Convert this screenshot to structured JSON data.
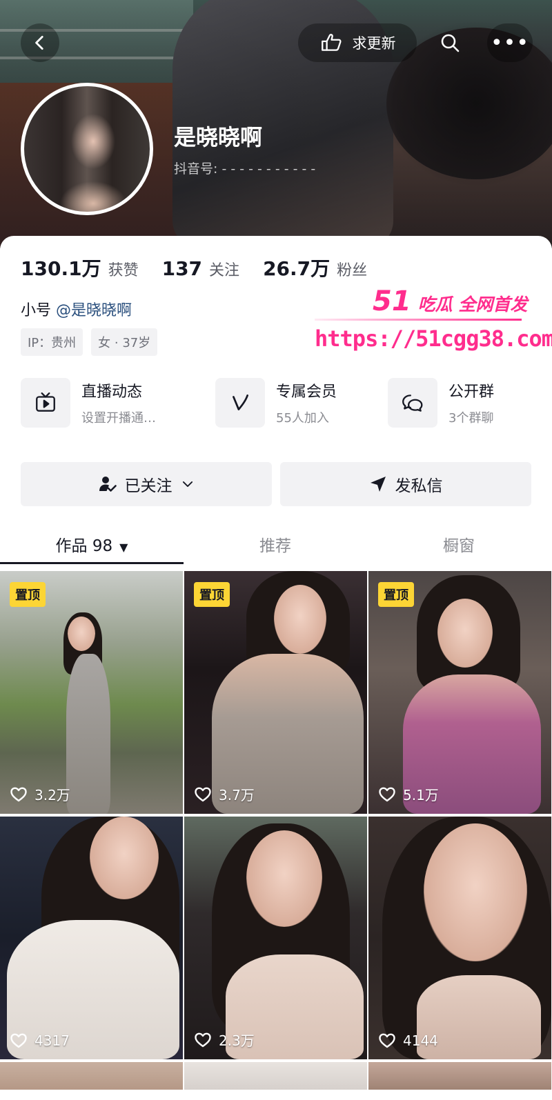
{
  "header": {
    "update_label": "求更新",
    "display_name": "是晓晓啊",
    "id_label": "抖音号: ",
    "id_value": "- - - - - - - - - - -"
  },
  "stats": [
    {
      "value": "130.1万",
      "label": "获赞"
    },
    {
      "value": "137",
      "label": "关注"
    },
    {
      "value": "26.7万",
      "label": "粉丝"
    }
  ],
  "alt_account": {
    "prefix": "小号",
    "handle": "@是晓晓啊"
  },
  "tags": [
    "IP：贵州",
    "女 · 37岁"
  ],
  "watermark": {
    "brand": "51",
    "slogan": "吃瓜 全网首发",
    "url": "https://51cgg38.com"
  },
  "features": [
    {
      "title": "直播动态",
      "subtitle": "设置开播通…",
      "icon": "tv-icon"
    },
    {
      "title": "专属会员",
      "subtitle": "55人加入",
      "icon": "v-badge-icon"
    },
    {
      "title": "公开群",
      "subtitle": "3个群聊",
      "icon": "chat-bubbles-icon"
    }
  ],
  "actions": {
    "followed_label": "已关注",
    "message_label": "发私信"
  },
  "tabs": [
    {
      "label": "作品 98",
      "active": true
    },
    {
      "label": "推荐",
      "active": false
    },
    {
      "label": "橱窗",
      "active": false
    }
  ],
  "videos": [
    {
      "pinned": "置顶",
      "likes": "3.2万"
    },
    {
      "pinned": "置顶",
      "likes": "3.7万"
    },
    {
      "pinned": "置顶",
      "likes": "5.1万"
    },
    {
      "likes": "4317"
    },
    {
      "likes": "2.3万"
    },
    {
      "likes": "4144"
    }
  ],
  "colors": {
    "accent_pink": "#ff2d8d",
    "pin_yellow": "#fcd535",
    "handle_blue": "#2a4f7d"
  }
}
